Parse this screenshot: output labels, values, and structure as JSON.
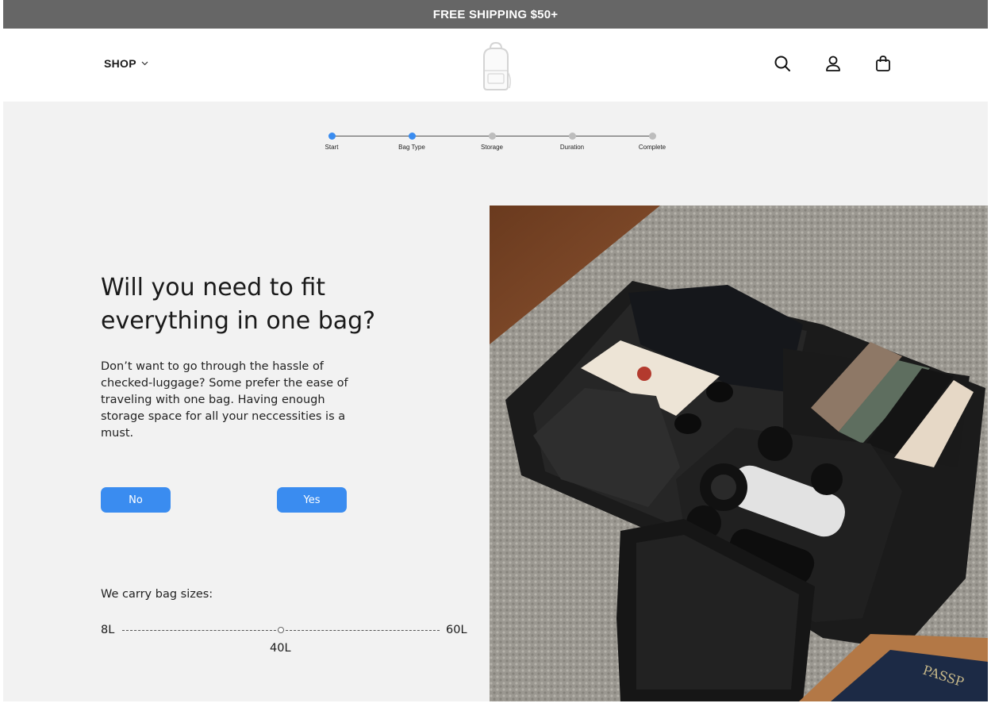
{
  "promo_banner": "FREE SHIPPING $50+",
  "nav": {
    "shop_label": "SHOP",
    "icons": [
      "search-icon",
      "account-icon",
      "cart-icon"
    ]
  },
  "stepper": {
    "steps": [
      "Start",
      "Bag Type",
      "Storage",
      "Duration",
      "Complete"
    ],
    "active_count": 2,
    "active_color": "#3a8cf0",
    "inactive_color": "#bdbdbd"
  },
  "question": {
    "heading": "Will you need to fit everything in one bag?",
    "description": "Don’t want to go through the hassle of checked-luggage? Some prefer the ease of traveling with one bag. Having enough storage space for all your neccessities is a must."
  },
  "answers": {
    "no_label": "No",
    "yes_label": "Yes"
  },
  "bag_sizes": {
    "title": "We carry bag sizes:",
    "min": "8L",
    "mid": "40L",
    "max": "60L"
  },
  "colors": {
    "accent": "#3a8cf0",
    "banner": "#666666",
    "background": "#f2f2f2"
  }
}
